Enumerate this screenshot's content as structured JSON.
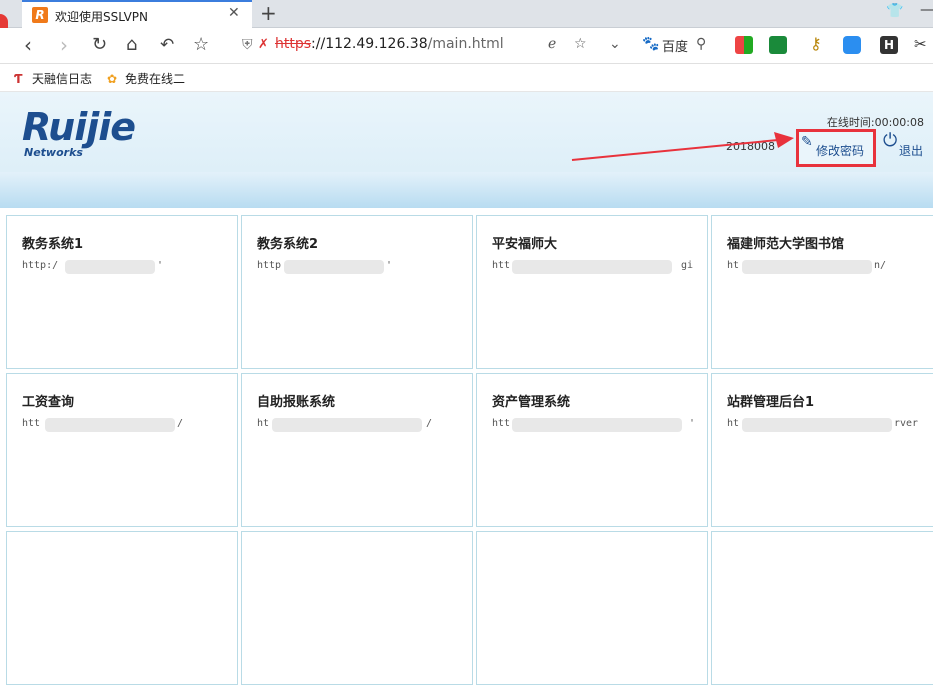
{
  "browser": {
    "tab_title": "欢迎使用SSLVPN",
    "url_scheme": "https",
    "url_host": "://112.49.126.38",
    "url_path": "/main.html",
    "search_hint": "百度",
    "bookmarks": [
      "天融信日志",
      "免费在线二"
    ]
  },
  "header": {
    "logo_text": "Ruijie",
    "logo_sub": "Networks",
    "online_time": "在线时间:00:00:08",
    "user_partial": "2018008",
    "change_password": "修改密码",
    "logout": "退出",
    "accent": "#e8323c"
  },
  "apps": [
    {
      "name": "教务系统1",
      "url": "http:/",
      "url_tail": "'"
    },
    {
      "name": "教务系统2",
      "url": "http",
      "url_tail": "'"
    },
    {
      "name": "平安福师大",
      "url": "htt",
      "url_tail": "gi"
    },
    {
      "name": "福建师范大学图书馆",
      "url": "ht",
      "url_tail": "n/"
    },
    {
      "name": "工资查询",
      "url": "htt",
      "url_tail": "/"
    },
    {
      "name": "自助报账系统",
      "url": "ht",
      "url_tail": "/"
    },
    {
      "name": "资产管理系统",
      "url": "htt",
      "url_tail": "'"
    },
    {
      "name": "站群管理后台1",
      "url": "ht",
      "url_tail": "rver"
    }
  ]
}
